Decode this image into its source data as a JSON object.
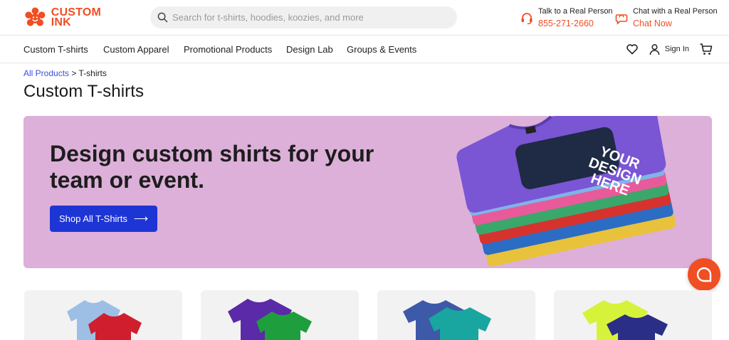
{
  "logo": {
    "line1": "CUSTOM",
    "line2": "INK"
  },
  "search": {
    "placeholder": "Search for t-shirts, hoodies, koozies, and more"
  },
  "contact_phone": {
    "label": "Talk to a Real Person",
    "value": "855-271-2660"
  },
  "contact_chat": {
    "label": "Chat with a Real Person",
    "value": "Chat Now"
  },
  "nav": {
    "items": [
      "Custom T-shirts",
      "Custom Apparel",
      "Promotional Products",
      "Design Lab",
      "Groups & Events"
    ],
    "signin": "Sign In"
  },
  "breadcrumb": {
    "parent": "All Products",
    "separator": ">",
    "current": "T-shirts"
  },
  "page": {
    "title": "Custom T-shirts"
  },
  "hero": {
    "heading": "Design custom shirts for your team or event.",
    "button": "Shop All T-Shirts",
    "shirt_text": [
      "YOUR",
      "DESIGN",
      "HERE"
    ]
  },
  "colors": {
    "brand": "#f04e23",
    "hero_bg": "#dcb0d9",
    "button": "#1e35d6",
    "link": "#3a4fd9"
  },
  "icons": [
    "search-icon",
    "headset-icon",
    "chat-bubble-icon",
    "heart-icon",
    "user-icon",
    "cart-icon",
    "arrow-right-icon",
    "chat-fab-icon"
  ]
}
